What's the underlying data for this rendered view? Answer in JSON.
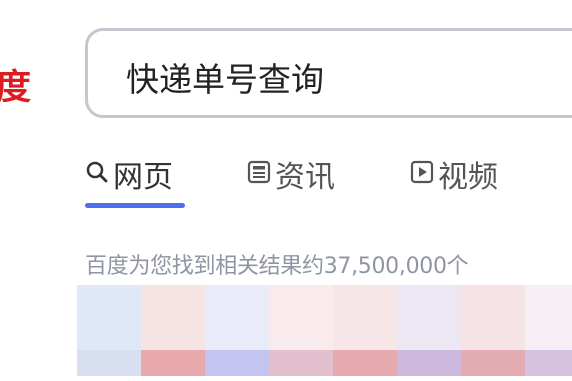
{
  "logo": {
    "visible_text": "度",
    "brand_color": "#de1b20"
  },
  "search": {
    "value": "快递单号查询"
  },
  "tabs": [
    {
      "label": "网页",
      "icon": "search-icon",
      "active": true
    },
    {
      "label": "资讯",
      "icon": "news-icon",
      "active": false
    },
    {
      "label": "视频",
      "icon": "video-play-icon",
      "active": false
    }
  ],
  "accent_color": "#4e6ef2",
  "results": {
    "count_text": "百度为您找到相关结果约37,500,000个"
  },
  "thumbnail_strip": {
    "cells": [
      {
        "top": "#dfe8f6",
        "bottom": "#d8dff0"
      },
      {
        "top": "#f6e3e4",
        "bottom": "#e8a9ad"
      },
      {
        "top": "#e9ebf8",
        "bottom": "#c4c4f0"
      },
      {
        "top": "#f8eaed",
        "bottom": "#e2c0ce"
      },
      {
        "top": "#f7e6e7",
        "bottom": "#e6a9ae"
      },
      {
        "top": "#ede7f4",
        "bottom": "#cdb9de"
      },
      {
        "top": "#f6e3e6",
        "bottom": "#e4adb3"
      },
      {
        "top": "#f5eef5",
        "bottom": "#d8c2e2"
      }
    ]
  }
}
